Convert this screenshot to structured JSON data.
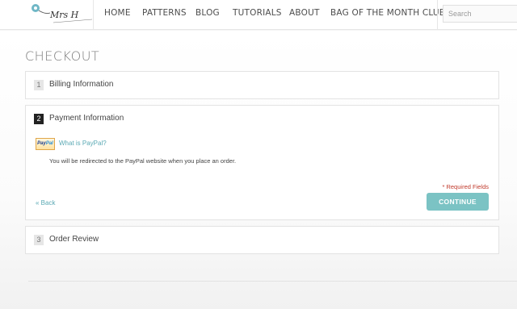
{
  "header": {
    "logo_text": "Mrs H",
    "nav": [
      {
        "label": "HOME"
      },
      {
        "label": "PATTERNS"
      },
      {
        "label": "BLOG"
      },
      {
        "label": "TUTORIALS"
      },
      {
        "label": "ABOUT"
      },
      {
        "label": "BAG OF THE MONTH CLUB"
      }
    ],
    "search": {
      "placeholder": "Search"
    }
  },
  "page": {
    "title": "CHECKOUT"
  },
  "steps": [
    {
      "number": "1",
      "title": "Billing Information",
      "active": false
    },
    {
      "number": "2",
      "title": "Payment Information",
      "active": true
    },
    {
      "number": "3",
      "title": "Order Review",
      "active": false
    }
  ],
  "payment": {
    "paypal_logo_text_a": "Pay",
    "paypal_logo_text_b": "Pal",
    "what_is_paypal": "What is PayPal?",
    "redirect_text": "You will be redirected to the PayPal website when you place an order.",
    "required_fields": "* Required Fields",
    "back_label": "« Back",
    "continue_label": "CONTINUE"
  },
  "colors": {
    "accent": "#7bc3c4",
    "link": "#5aa9b4",
    "required": "#c0392b"
  }
}
